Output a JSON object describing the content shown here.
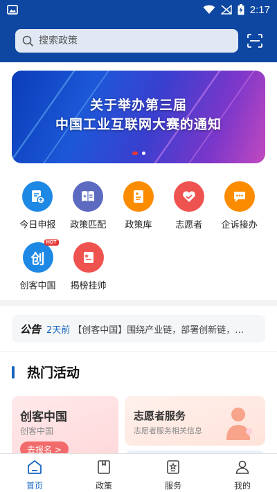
{
  "status_bar": {
    "time": "2:17"
  },
  "search": {
    "placeholder": "搜索政策"
  },
  "banner": {
    "line1": "关于举办第三届",
    "line2": "中国工业互联网大赛的通知"
  },
  "quick_menu": [
    {
      "label": "今日申报",
      "icon": "document-upload-icon",
      "color": "#1e88e5"
    },
    {
      "label": "政策匹配",
      "icon": "book-star-icon",
      "color": "#5c6bc0"
    },
    {
      "label": "政策库",
      "icon": "policy-doc-icon",
      "color": "#fb8c00"
    },
    {
      "label": "志愿者",
      "icon": "heart-icon",
      "color": "#ef5350"
    },
    {
      "label": "企诉接办",
      "icon": "chat-icon",
      "color": "#fb8c00"
    },
    {
      "label": "创客中国",
      "icon": "chuang-logo-icon",
      "color": "#1e88e5",
      "badge": "HOT"
    },
    {
      "label": "揭榜挂帅",
      "icon": "flag-doc-icon",
      "color": "#ef5350"
    }
  ],
  "notice": {
    "tag": "公告",
    "time": "2天前",
    "text": "【创客中国】围绕产业链，部署创新链，…"
  },
  "section": {
    "title": "热门活动"
  },
  "cards": {
    "left": {
      "title": "创客中国",
      "subtitle": "创客中国",
      "button": "去报名 >"
    },
    "right": {
      "title": "志愿者服务",
      "subtitle": "志愿者服务相关信息"
    }
  },
  "bottom_nav": [
    {
      "label": "首页",
      "icon": "home-icon",
      "active": true
    },
    {
      "label": "政策",
      "icon": "bookmark-doc-icon",
      "active": false
    },
    {
      "label": "服务",
      "icon": "star-badge-icon",
      "active": false
    },
    {
      "label": "我的",
      "icon": "user-icon",
      "active": false
    }
  ],
  "colors": {
    "primary": "#0d47a1",
    "accent": "#1565c0",
    "red": "#e53935"
  }
}
